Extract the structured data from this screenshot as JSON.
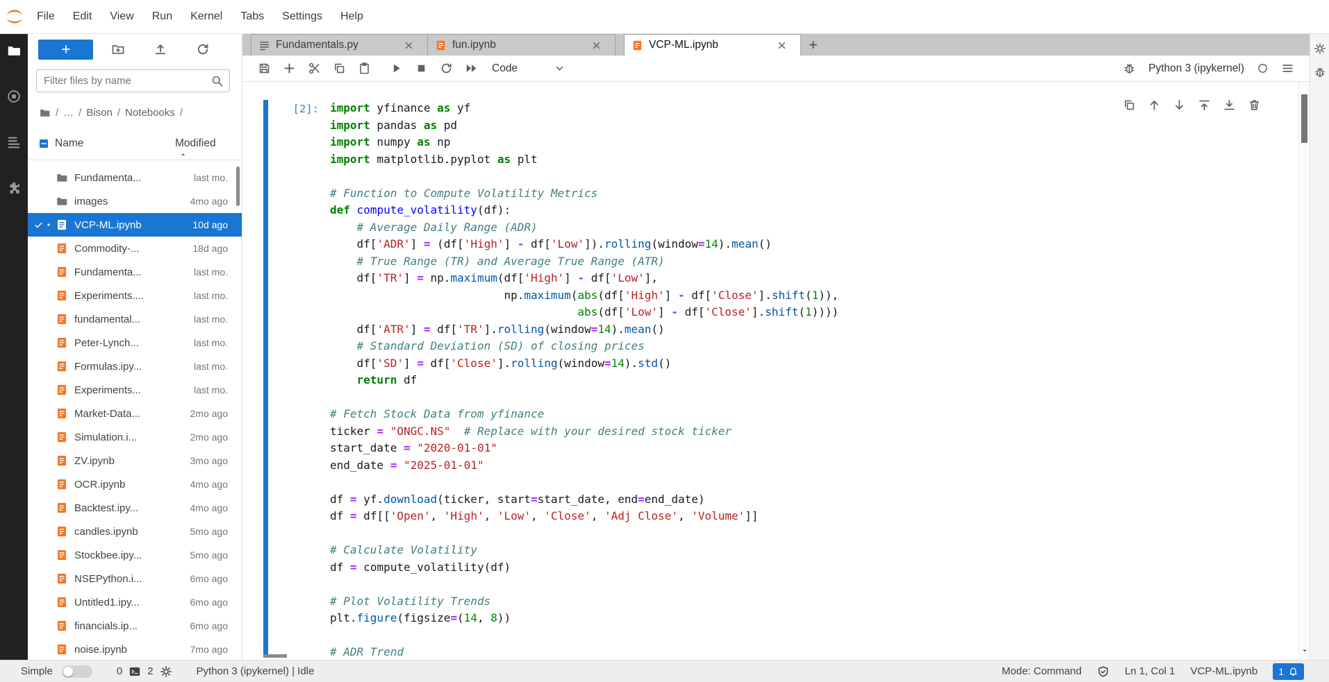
{
  "menu": {
    "items": [
      "File",
      "Edit",
      "View",
      "Run",
      "Kernel",
      "Tabs",
      "Settings",
      "Help"
    ]
  },
  "activity_bar": {
    "items": [
      {
        "id": "file-browser",
        "icon": "folder",
        "active": true
      },
      {
        "id": "running-sessions",
        "icon": "running",
        "active": false
      },
      {
        "id": "table-of-contents",
        "icon": "list",
        "active": false
      },
      {
        "id": "extension-manager",
        "icon": "puzzle",
        "active": false
      }
    ]
  },
  "right_bar": {
    "items": [
      {
        "id": "property-inspector",
        "icon": "gear"
      },
      {
        "id": "debugger",
        "icon": "bug"
      }
    ]
  },
  "file_browser": {
    "toolbar": {
      "actions": [
        {
          "id": "new-folder",
          "icon": "new-folder"
        },
        {
          "id": "upload-files",
          "icon": "upload"
        },
        {
          "id": "refresh-file-list",
          "icon": "refresh"
        }
      ]
    },
    "filter_placeholder": "Filter files by name",
    "breadcrumb": {
      "separator": "/",
      "items": [
        "…",
        "Bison",
        "Notebooks"
      ]
    },
    "columns": {
      "name": "Name",
      "modified": "Modified"
    },
    "files": [
      {
        "name": "Fundamenta...",
        "modified": "last mo.",
        "type": "folder"
      },
      {
        "name": "images",
        "modified": "4mo ago",
        "type": "folder"
      },
      {
        "name": "VCP-ML.ipynb",
        "modified": "10d ago",
        "type": "notebook",
        "selected": true
      },
      {
        "name": "Commodity-...",
        "modified": "18d ago",
        "type": "notebook"
      },
      {
        "name": "Fundamenta...",
        "modified": "last mo.",
        "type": "notebook"
      },
      {
        "name": "Experiments....",
        "modified": "last mo.",
        "type": "notebook"
      },
      {
        "name": "fundamental...",
        "modified": "last mo.",
        "type": "notebook"
      },
      {
        "name": "Peter-Lynch...",
        "modified": "last mo.",
        "type": "notebook"
      },
      {
        "name": "Formulas.ipy...",
        "modified": "last mo.",
        "type": "notebook"
      },
      {
        "name": "Experiments...",
        "modified": "last mo.",
        "type": "notebook"
      },
      {
        "name": "Market-Data...",
        "modified": "2mo ago",
        "type": "notebook"
      },
      {
        "name": "Simulation.i...",
        "modified": "2mo ago",
        "type": "notebook"
      },
      {
        "name": "ZV.ipynb",
        "modified": "3mo ago",
        "type": "notebook"
      },
      {
        "name": "OCR.ipynb",
        "modified": "4mo ago",
        "type": "notebook"
      },
      {
        "name": "Backtest.ipy...",
        "modified": "4mo ago",
        "type": "notebook"
      },
      {
        "name": "candles.ipynb",
        "modified": "5mo ago",
        "type": "notebook"
      },
      {
        "name": "Stockbee.ipy...",
        "modified": "5mo ago",
        "type": "notebook"
      },
      {
        "name": "NSEPython.i...",
        "modified": "6mo ago",
        "type": "notebook"
      },
      {
        "name": "Untitled1.ipy...",
        "modified": "6mo ago",
        "type": "notebook"
      },
      {
        "name": "financials.ip...",
        "modified": "6mo ago",
        "type": "notebook"
      },
      {
        "name": "noise.ipynb",
        "modified": "7mo ago",
        "type": "notebook"
      }
    ]
  },
  "tabs": [
    {
      "label": "Fundamentals.py",
      "icon": "text-file",
      "active": false
    },
    {
      "label": "fun.ipynb",
      "icon": "notebook",
      "active": false
    },
    {
      "label": "VCP-ML.ipynb",
      "icon": "notebook",
      "active": true
    }
  ],
  "notebook_toolbar": {
    "buttons": [
      {
        "id": "save",
        "icon": "save"
      },
      {
        "id": "insert-cell",
        "icon": "plus"
      },
      {
        "id": "cut-cell",
        "icon": "cut"
      },
      {
        "id": "copy-cell",
        "icon": "copy"
      },
      {
        "id": "paste-cell",
        "icon": "paste"
      },
      {
        "id": "run-cell",
        "icon": "run",
        "group": true
      },
      {
        "id": "interrupt-kernel",
        "icon": "stop"
      },
      {
        "id": "restart-kernel",
        "icon": "refresh"
      },
      {
        "id": "restart-run-all",
        "icon": "fast-forward"
      }
    ],
    "cell_type": "Code",
    "kernel": {
      "name": "Python 3 (ipykernel)"
    }
  },
  "cell": {
    "prompt": "[2]:",
    "actions": [
      {
        "id": "duplicate-cell",
        "icon": "copy"
      },
      {
        "id": "move-cell-up",
        "icon": "arrow-up"
      },
      {
        "id": "move-cell-down",
        "icon": "arrow-down"
      },
      {
        "id": "insert-cell-above",
        "icon": "insert-above"
      },
      {
        "id": "insert-cell-below",
        "icon": "insert-below"
      },
      {
        "id": "delete-cell",
        "icon": "trash"
      }
    ],
    "code_lines": [
      [
        [
          "k",
          "import"
        ],
        [
          "p",
          " yfinance "
        ],
        [
          "k",
          "as"
        ],
        [
          "p",
          " yf"
        ]
      ],
      [
        [
          "k",
          "import"
        ],
        [
          "p",
          " pandas "
        ],
        [
          "k",
          "as"
        ],
        [
          "p",
          " pd"
        ]
      ],
      [
        [
          "k",
          "import"
        ],
        [
          "p",
          " numpy "
        ],
        [
          "k",
          "as"
        ],
        [
          "p",
          " np"
        ]
      ],
      [
        [
          "k",
          "import"
        ],
        [
          "p",
          " matplotlib.pyplot "
        ],
        [
          "k",
          "as"
        ],
        [
          "p",
          " plt"
        ]
      ],
      [],
      [
        [
          "c",
          "# Function to Compute Volatility Metrics"
        ]
      ],
      [
        [
          "k",
          "def"
        ],
        [
          "p",
          " "
        ],
        [
          "f",
          "compute_volatility"
        ],
        [
          "p",
          "(df):"
        ]
      ],
      [
        [
          "p",
          "    "
        ],
        [
          "c",
          "# Average Daily Range (ADR)"
        ]
      ],
      [
        [
          "p",
          "    df["
        ],
        [
          "s",
          "'ADR'"
        ],
        [
          "p",
          "] "
        ],
        [
          "o",
          "="
        ],
        [
          "p",
          " (df["
        ],
        [
          "s",
          "'High'"
        ],
        [
          "p",
          "] "
        ],
        [
          "o",
          "-"
        ],
        [
          "p",
          " df["
        ],
        [
          "s",
          "'Low'"
        ],
        [
          "p",
          "])."
        ],
        [
          "m",
          "rolling"
        ],
        [
          "p",
          "(window"
        ],
        [
          "o",
          "="
        ],
        [
          "n",
          "14"
        ],
        [
          "p",
          ")."
        ],
        [
          "m",
          "mean"
        ],
        [
          "p",
          "()"
        ]
      ],
      [
        [
          "p",
          "    "
        ],
        [
          "c",
          "# True Range (TR) and Average True Range (ATR)"
        ]
      ],
      [
        [
          "p",
          "    df["
        ],
        [
          "s",
          "'TR'"
        ],
        [
          "p",
          "] "
        ],
        [
          "o",
          "="
        ],
        [
          "p",
          " np."
        ],
        [
          "m",
          "maximum"
        ],
        [
          "p",
          "(df["
        ],
        [
          "s",
          "'High'"
        ],
        [
          "p",
          "] "
        ],
        [
          "o",
          "-"
        ],
        [
          "p",
          " df["
        ],
        [
          "s",
          "'Low'"
        ],
        [
          "p",
          "],"
        ]
      ],
      [
        [
          "p",
          "                          np."
        ],
        [
          "m",
          "maximum"
        ],
        [
          "p",
          "("
        ],
        [
          "b",
          "abs"
        ],
        [
          "p",
          "(df["
        ],
        [
          "s",
          "'High'"
        ],
        [
          "p",
          "] "
        ],
        [
          "o",
          "-"
        ],
        [
          "p",
          " df["
        ],
        [
          "s",
          "'Close'"
        ],
        [
          "p",
          "]."
        ],
        [
          "m",
          "shift"
        ],
        [
          "p",
          "("
        ],
        [
          "n",
          "1"
        ],
        [
          "p",
          ")),"
        ]
      ],
      [
        [
          "p",
          "                                     "
        ],
        [
          "b",
          "abs"
        ],
        [
          "p",
          "(df["
        ],
        [
          "s",
          "'Low'"
        ],
        [
          "p",
          "] "
        ],
        [
          "o",
          "-"
        ],
        [
          "p",
          " df["
        ],
        [
          "s",
          "'Close'"
        ],
        [
          "p",
          "]."
        ],
        [
          "m",
          "shift"
        ],
        [
          "p",
          "("
        ],
        [
          "n",
          "1"
        ],
        [
          "p",
          "))))"
        ]
      ],
      [
        [
          "p",
          "    df["
        ],
        [
          "s",
          "'ATR'"
        ],
        [
          "p",
          "] "
        ],
        [
          "o",
          "="
        ],
        [
          "p",
          " df["
        ],
        [
          "s",
          "'TR'"
        ],
        [
          "p",
          "]."
        ],
        [
          "m",
          "rolling"
        ],
        [
          "p",
          "(window"
        ],
        [
          "o",
          "="
        ],
        [
          "n",
          "14"
        ],
        [
          "p",
          ")."
        ],
        [
          "m",
          "mean"
        ],
        [
          "p",
          "()"
        ]
      ],
      [
        [
          "p",
          "    "
        ],
        [
          "c",
          "# Standard Deviation (SD) of closing prices"
        ]
      ],
      [
        [
          "p",
          "    df["
        ],
        [
          "s",
          "'SD'"
        ],
        [
          "p",
          "] "
        ],
        [
          "o",
          "="
        ],
        [
          "p",
          " df["
        ],
        [
          "s",
          "'Close'"
        ],
        [
          "p",
          "]."
        ],
        [
          "m",
          "rolling"
        ],
        [
          "p",
          "(window"
        ],
        [
          "o",
          "="
        ],
        [
          "n",
          "14"
        ],
        [
          "p",
          ")."
        ],
        [
          "m",
          "std"
        ],
        [
          "p",
          "()"
        ]
      ],
      [
        [
          "p",
          "    "
        ],
        [
          "k",
          "return"
        ],
        [
          "p",
          " df"
        ]
      ],
      [],
      [
        [
          "c",
          "# Fetch Stock Data from yfinance"
        ]
      ],
      [
        [
          "p",
          "ticker "
        ],
        [
          "o",
          "="
        ],
        [
          "p",
          " "
        ],
        [
          "s",
          "\"ONGC.NS\""
        ],
        [
          "p",
          "  "
        ],
        [
          "c",
          "# Replace with your desired stock ticker"
        ]
      ],
      [
        [
          "p",
          "start_date "
        ],
        [
          "o",
          "="
        ],
        [
          "p",
          " "
        ],
        [
          "s",
          "\"2020-01-01\""
        ]
      ],
      [
        [
          "p",
          "end_date "
        ],
        [
          "o",
          "="
        ],
        [
          "p",
          " "
        ],
        [
          "s",
          "\"2025-01-01\""
        ]
      ],
      [],
      [
        [
          "p",
          "df "
        ],
        [
          "o",
          "="
        ],
        [
          "p",
          " yf."
        ],
        [
          "m",
          "download"
        ],
        [
          "p",
          "(ticker, start"
        ],
        [
          "o",
          "="
        ],
        [
          "p",
          "start_date, end"
        ],
        [
          "o",
          "="
        ],
        [
          "p",
          "end_date)"
        ]
      ],
      [
        [
          "p",
          "df "
        ],
        [
          "o",
          "="
        ],
        [
          "p",
          " df[["
        ],
        [
          "s",
          "'Open'"
        ],
        [
          "p",
          ", "
        ],
        [
          "s",
          "'High'"
        ],
        [
          "p",
          ", "
        ],
        [
          "s",
          "'Low'"
        ],
        [
          "p",
          ", "
        ],
        [
          "s",
          "'Close'"
        ],
        [
          "p",
          ", "
        ],
        [
          "s",
          "'Adj Close'"
        ],
        [
          "p",
          ", "
        ],
        [
          "s",
          "'Volume'"
        ],
        [
          "p",
          "]]"
        ]
      ],
      [],
      [
        [
          "c",
          "# Calculate Volatility"
        ]
      ],
      [
        [
          "p",
          "df "
        ],
        [
          "o",
          "="
        ],
        [
          "p",
          " compute_volatility(df)"
        ]
      ],
      [],
      [
        [
          "c",
          "# Plot Volatility Trends"
        ]
      ],
      [
        [
          "p",
          "plt."
        ],
        [
          "m",
          "figure"
        ],
        [
          "p",
          "(figsize"
        ],
        [
          "o",
          "="
        ],
        [
          "p",
          "("
        ],
        [
          "n",
          "14"
        ],
        [
          "p",
          ", "
        ],
        [
          "n",
          "8"
        ],
        [
          "p",
          "))"
        ]
      ],
      [],
      [
        [
          "c",
          "# ADR Trend"
        ]
      ]
    ]
  },
  "status_bar": {
    "simple_label": "Simple",
    "terminal_count": "0",
    "kernel_count": "2",
    "kernel_status": "Python 3 (ipykernel) | Idle",
    "mode": "Mode: Command",
    "cursor": "Ln 1, Col 1",
    "filename": "VCP-ML.ipynb",
    "notification_count": "1"
  },
  "colors": {
    "accent": "#1976d2",
    "notebook_icon": "#f37726",
    "active_cell_bar": "#1976d2"
  }
}
